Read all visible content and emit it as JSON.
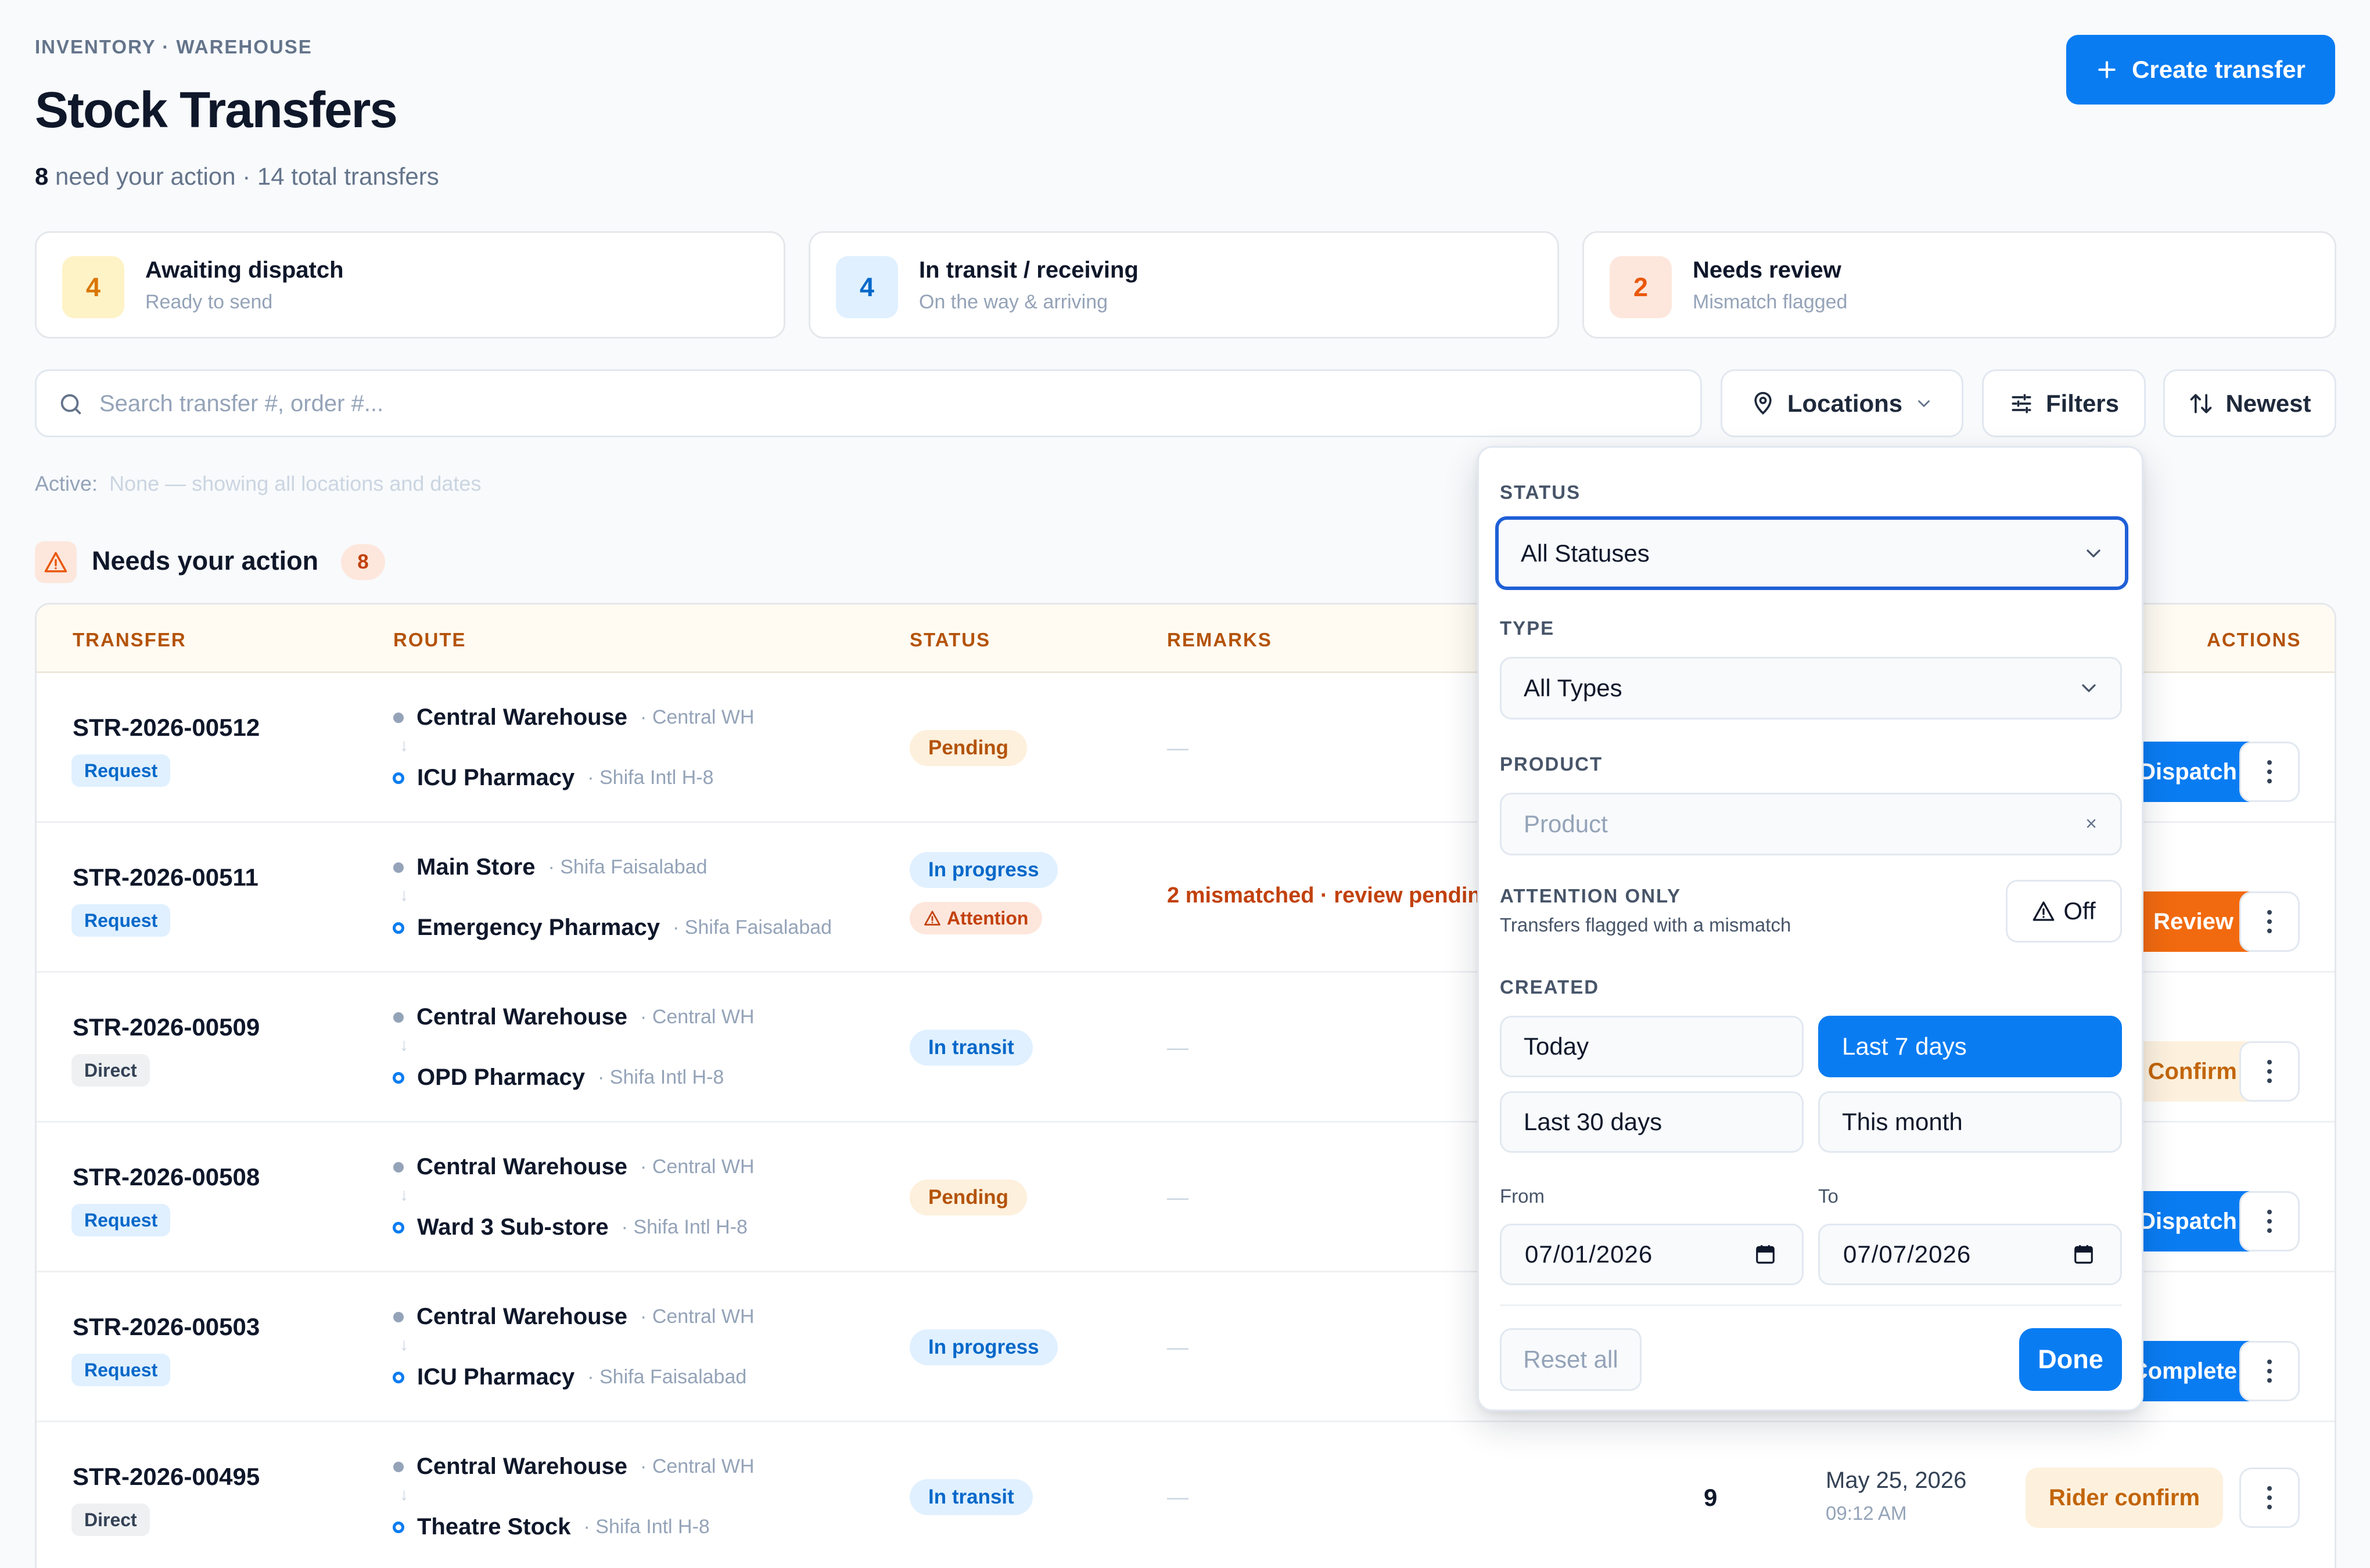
{
  "header": {
    "breadcrumb": "INVENTORY · WAREHOUSE",
    "title": "Stock Transfers",
    "action_count": "8",
    "subtitle_rest": " need your action · 14 total transfers",
    "create_button": "Create transfer"
  },
  "summary_cards": [
    {
      "count": "4",
      "title": "Awaiting dispatch",
      "subtitle": "Ready to send",
      "color": "#d97706",
      "bg": "#fef3c7"
    },
    {
      "count": "4",
      "title": "In transit / receiving",
      "subtitle": "On the way & arriving",
      "color": "#0568c9",
      "bg": "#e0f0ff"
    },
    {
      "count": "2",
      "title": "Needs review",
      "subtitle": "Mismatch flagged",
      "color": "#ea580c",
      "bg": "#fde7dd"
    }
  ],
  "toolbar": {
    "search_placeholder": "Search transfer #, order #...",
    "locations_label": "Locations",
    "filters_label": "Filters",
    "sort_label": "Newest"
  },
  "active_filters": {
    "label": "Active:",
    "value": "None — showing all locations and dates"
  },
  "section": {
    "title": "Needs your action",
    "count": "8"
  },
  "table": {
    "columns": {
      "transfer": "TRANSFER",
      "route": "ROUTE",
      "status": "STATUS",
      "remarks": "REMARKS",
      "actions": "ACTIONS"
    },
    "rows": [
      {
        "id": "STR-2026-00512",
        "type": "Request",
        "from": "Central Warehouse",
        "from_site": "· Central WH",
        "to": "ICU Pharmacy",
        "to_site": "· Shifa Intl H-8",
        "status": "Pending",
        "attention": "",
        "remark": "—",
        "action": "Dispatch",
        "items": "",
        "date": "",
        "time": ""
      },
      {
        "id": "STR-2026-00511",
        "type": "Request",
        "from": "Main Store",
        "from_site": "· Shifa Faisalabad",
        "to": "Emergency Pharmacy",
        "to_site": "· Shifa Faisalabad",
        "status": "In progress",
        "attention": "Attention",
        "remark": "2 mismatched · review pending",
        "action": "Review",
        "items": "",
        "date": "",
        "time": ""
      },
      {
        "id": "STR-2026-00509",
        "type": "Direct",
        "from": "Central Warehouse",
        "from_site": "· Central WH",
        "to": "OPD Pharmacy",
        "to_site": "· Shifa Intl H-8",
        "status": "In transit",
        "attention": "",
        "remark": "—",
        "action": "Confirm",
        "items": "",
        "date": "",
        "time": ""
      },
      {
        "id": "STR-2026-00508",
        "type": "Request",
        "from": "Central Warehouse",
        "from_site": "· Central WH",
        "to": "Ward 3 Sub-store",
        "to_site": "· Shifa Intl H-8",
        "status": "Pending",
        "attention": "",
        "remark": "—",
        "action": "Dispatch",
        "items": "",
        "date": "",
        "time": ""
      },
      {
        "id": "STR-2026-00503",
        "type": "Request",
        "from": "Central Warehouse",
        "from_site": "· Central WH",
        "to": "ICU Pharmacy",
        "to_site": "· Shifa Faisalabad",
        "status": "In progress",
        "attention": "",
        "remark": "—",
        "action": "Complete",
        "items": "",
        "date": "",
        "time": ""
      },
      {
        "id": "STR-2026-00495",
        "type": "Direct",
        "from": "Central Warehouse",
        "from_site": "· Central WH",
        "to": "Theatre Stock",
        "to_site": "· Shifa Intl H-8",
        "status": "In transit",
        "attention": "",
        "remark": "—",
        "action": "Rider confirm",
        "items": "9",
        "date": "May 25, 2026",
        "time": "09:12 AM"
      }
    ]
  },
  "filter_panel": {
    "status_label": "STATUS",
    "status_value": "All Statuses",
    "type_label": "TYPE",
    "type_value": "All Types",
    "product_label": "PRODUCT",
    "product_placeholder": "Product",
    "product_clear": "×",
    "attention_label": "ATTENTION ONLY",
    "attention_sub": "Transfers flagged with a mismatch",
    "attention_value": "Off",
    "created_label": "CREATED",
    "ranges": [
      "Today",
      "Last 7 days",
      "Last 30 days",
      "This month"
    ],
    "selected_range": "Last 7 days",
    "from_label": "From",
    "from_value": "07/01/2026",
    "to_label": "To",
    "to_value": "07/07/2026",
    "reset_label": "Reset all",
    "done_label": "Done"
  },
  "colors": {
    "primary": "#0a7cf2",
    "warning": "#f26a0f",
    "focus": "#1f5fd6"
  }
}
